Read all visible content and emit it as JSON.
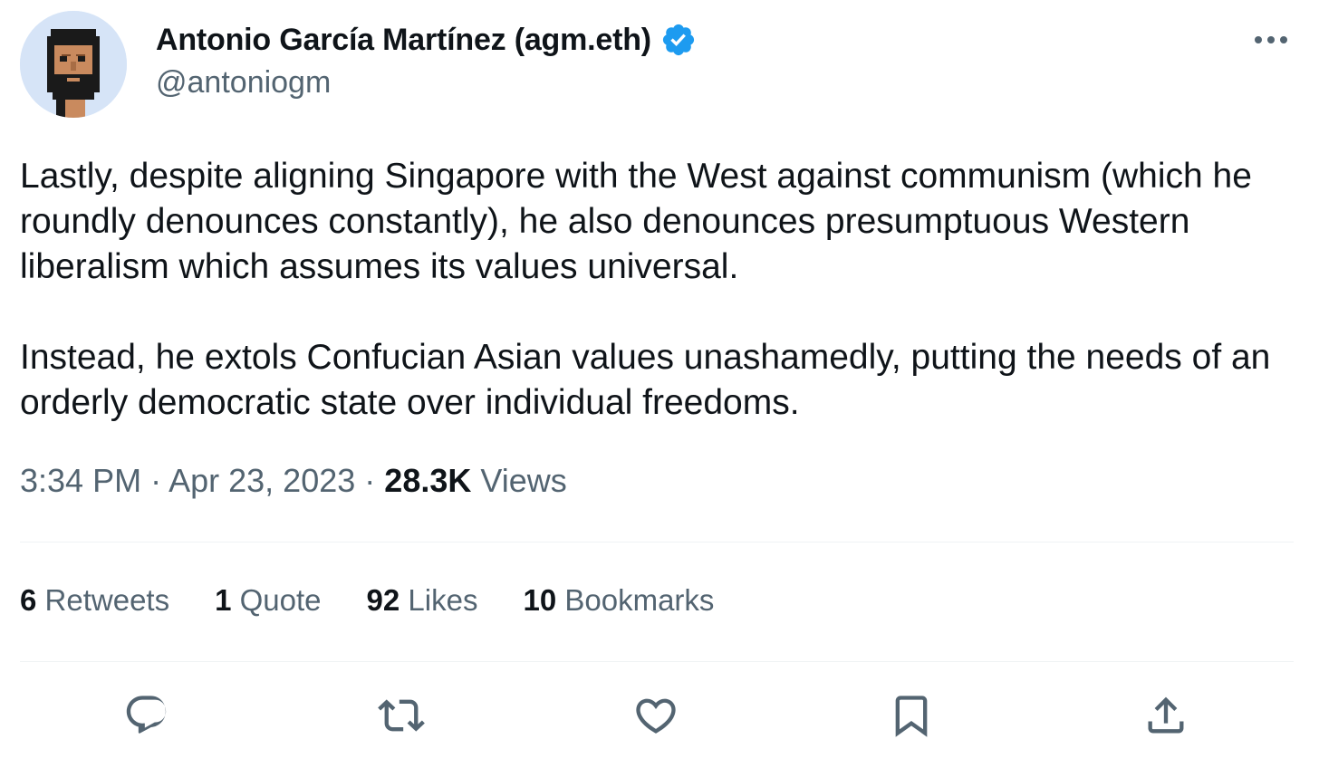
{
  "author": {
    "display_name": "Antonio García Martínez (agm.eth)",
    "handle": "@antoniogm",
    "verified_icon": "verified-badge-icon",
    "verified_color": "#1d9bf0"
  },
  "tweet": {
    "paragraphs": [
      "Lastly, despite aligning Singapore with the West against communism (which he roundly denounces constantly), he also denounces presumptuous Western liberalism which assumes its values universal.",
      "Instead, he extols Confucian Asian values unashamedly, putting the needs of an orderly democratic state over individual freedoms."
    ]
  },
  "meta": {
    "time": "3:34 PM",
    "separator": "·",
    "date": "Apr 23, 2023",
    "views_count": "28.3K",
    "views_label": "Views"
  },
  "stats": {
    "retweets": {
      "count": "6",
      "label": "Retweets"
    },
    "quotes": {
      "count": "1",
      "label": "Quote"
    },
    "likes": {
      "count": "92",
      "label": "Likes"
    },
    "bookmarks": {
      "count": "10",
      "label": "Bookmarks"
    }
  },
  "actions": [
    "reply-icon",
    "retweet-icon",
    "like-icon",
    "bookmark-icon",
    "share-icon"
  ],
  "colors": {
    "text_primary": "#0f1419",
    "text_secondary": "#536471",
    "divider": "#eff3f4",
    "accent": "#1d9bf0"
  }
}
